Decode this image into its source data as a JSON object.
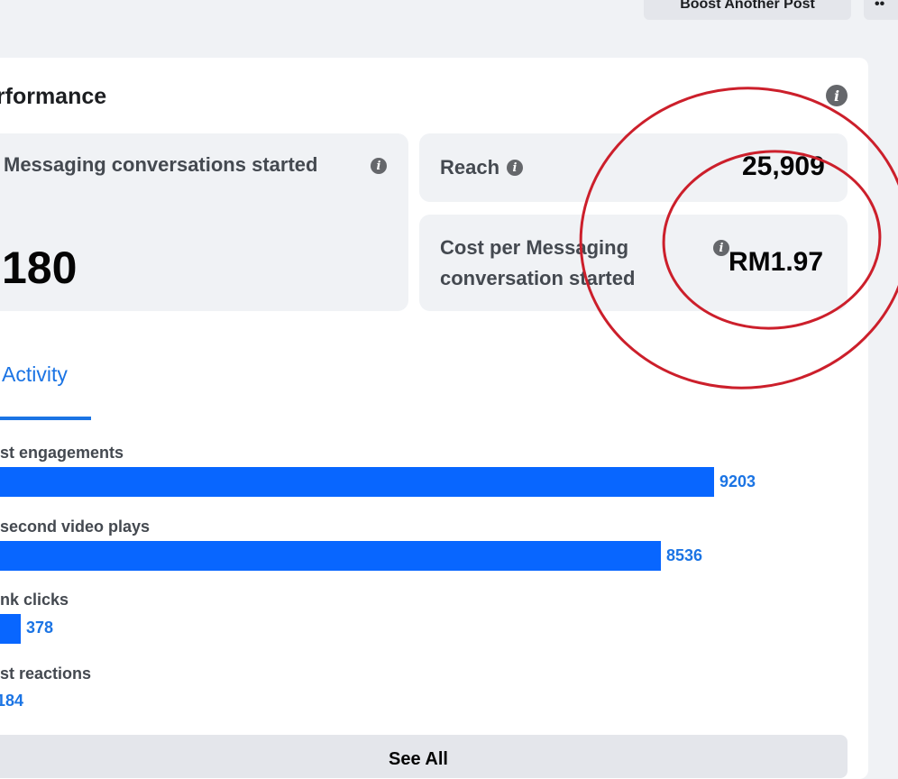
{
  "header": {
    "boost_button": "Boost Another Post",
    "more_button": "••"
  },
  "performance": {
    "title": "erformance",
    "messaging": {
      "label": "Messaging conversations started",
      "value": "180"
    },
    "reach": {
      "label": "Reach",
      "value": "25,909"
    },
    "cost": {
      "label_line1": "Cost per Messaging",
      "label_line2": "conversation started",
      "value": "RM1.97"
    }
  },
  "activity": {
    "tab_label": "Activity",
    "rows": [
      {
        "label": "st engagements",
        "value": "9203",
        "fraction": 0.853
      },
      {
        "label": "second video plays",
        "value": "8536",
        "fraction": 0.79
      },
      {
        "label": "nk clicks",
        "value": "378",
        "fraction": 0.035
      },
      {
        "label": "st reactions",
        "value": "184",
        "fraction": 0
      }
    ],
    "see_all": "See All"
  },
  "colors": {
    "accent": "#1b74e4",
    "bar": "#0866ff",
    "annotation": "#cc1f2b"
  },
  "icons": [
    "info-icon"
  ]
}
